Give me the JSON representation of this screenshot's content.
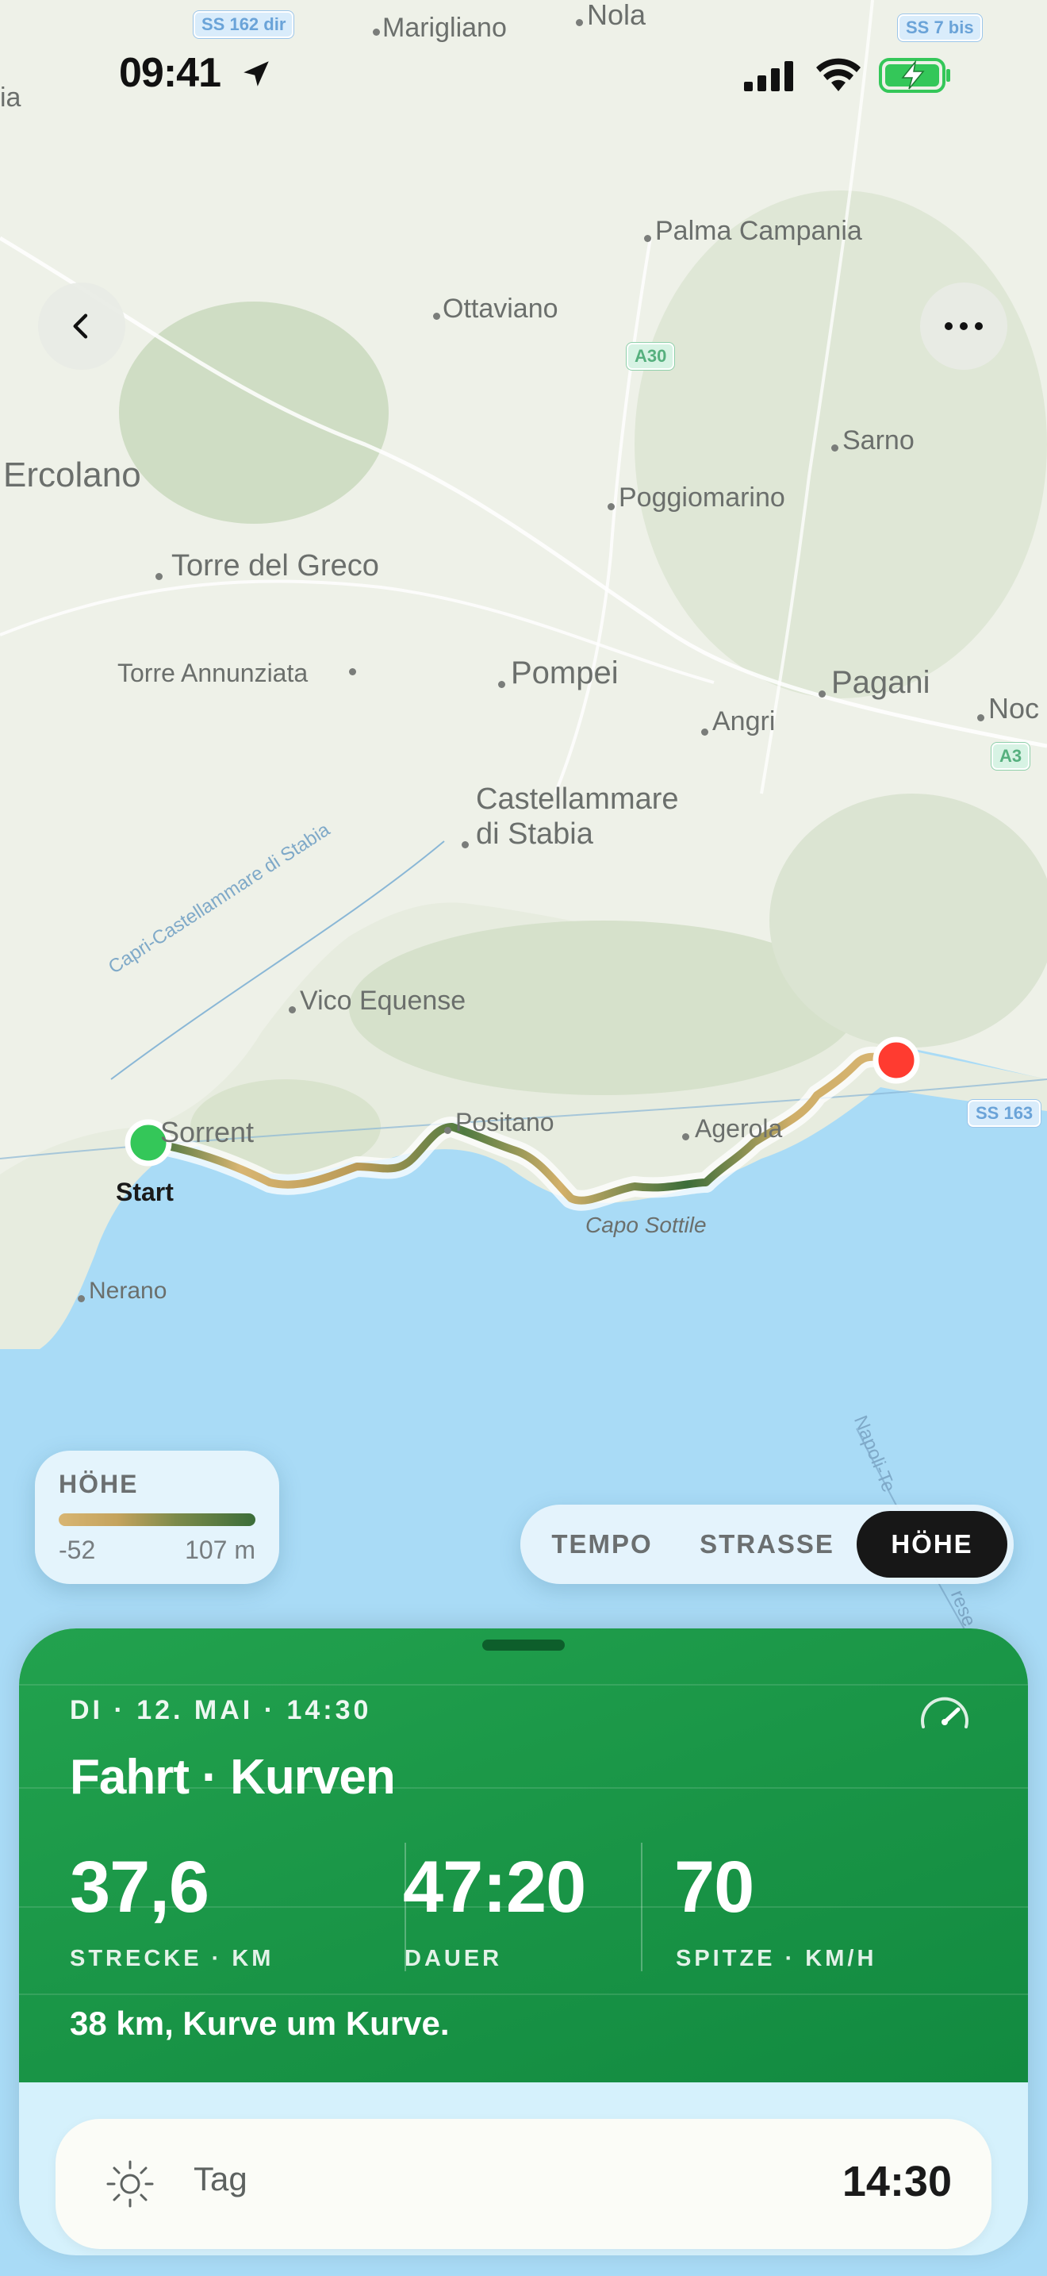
{
  "status": {
    "time": "09:41",
    "icons": [
      "location-arrow-icon",
      "cellular-signal-icon",
      "wifi-icon",
      "battery-charging-icon"
    ]
  },
  "nav": {
    "back_icon": "chevron-left-icon",
    "more_icon": "ellipsis-icon"
  },
  "map": {
    "places": [
      {
        "name": "Marigliano",
        "id": "marigliano"
      },
      {
        "name": "Nola",
        "id": "nola"
      },
      {
        "name": "ia",
        "id": "edge-ia"
      },
      {
        "name": "Palma Campania",
        "id": "palma-campania"
      },
      {
        "name": "Ottaviano",
        "id": "ottaviano"
      },
      {
        "name": "Sarno",
        "id": "sarno"
      },
      {
        "name": "Ercolano",
        "id": "ercolano"
      },
      {
        "name": "Poggiomarino",
        "id": "poggiomarino"
      },
      {
        "name": "Torre del Greco",
        "id": "torre-del-greco"
      },
      {
        "name": "Torre Annunziata",
        "id": "torre-annunziata"
      },
      {
        "name": "Pompei",
        "id": "pompei"
      },
      {
        "name": "Pagani",
        "id": "pagani"
      },
      {
        "name": "Angri",
        "id": "angri"
      },
      {
        "name": "Noc",
        "id": "nocera-edge"
      },
      {
        "name": "Castellammare",
        "id": "castellammare-1"
      },
      {
        "name": "di Stabia",
        "id": "castellammare-2"
      },
      {
        "name": "Vico Equense",
        "id": "vico-equense"
      },
      {
        "name": "Sorrent",
        "id": "sorrent"
      },
      {
        "name": "Positano",
        "id": "positano"
      },
      {
        "name": "Agerola",
        "id": "agerola"
      },
      {
        "name": "Capo Sottile",
        "id": "capo-sottile"
      },
      {
        "name": "Nerano",
        "id": "nerano"
      }
    ],
    "ferry_label": "Capri-Castellammare di Stabia",
    "ferry_label_2": "Napoli-Te",
    "ferry_label_3": "rese",
    "road_badges": [
      {
        "label": "SS 162 dir"
      },
      {
        "label": "SS 7 bis"
      },
      {
        "label": "A30"
      },
      {
        "label": "A3"
      },
      {
        "label": "SS 163"
      }
    ],
    "start_label": "Start",
    "colors": {
      "water": "#a9dbf6",
      "land": "#eef1e8",
      "route_low": "#d8b572",
      "route_high": "#3b6d39",
      "start": "#34c759",
      "end": "#ff3b30"
    }
  },
  "legend": {
    "title": "HÖHE",
    "min": "-52",
    "max": "107 m"
  },
  "segments": {
    "items": [
      "TEMPO",
      "STRASSE",
      "HÖHE"
    ],
    "selected": "HÖHE"
  },
  "trip": {
    "meta": "DI · 12. MAI · 14:30",
    "title": "Fahrt · Kurven",
    "stats": [
      {
        "value": "37,6",
        "label": "STRECKE · KM"
      },
      {
        "value": "47:20",
        "label": "DAUER"
      },
      {
        "value": "70",
        "label": "SPITZE · KM/H"
      }
    ],
    "summary": "38 km, Kurve um Kurve.",
    "icon": "speedometer-icon",
    "accent": "#1a9a48"
  },
  "daymode": {
    "icon": "sun-icon",
    "label": "Tag",
    "time": "14:30"
  }
}
